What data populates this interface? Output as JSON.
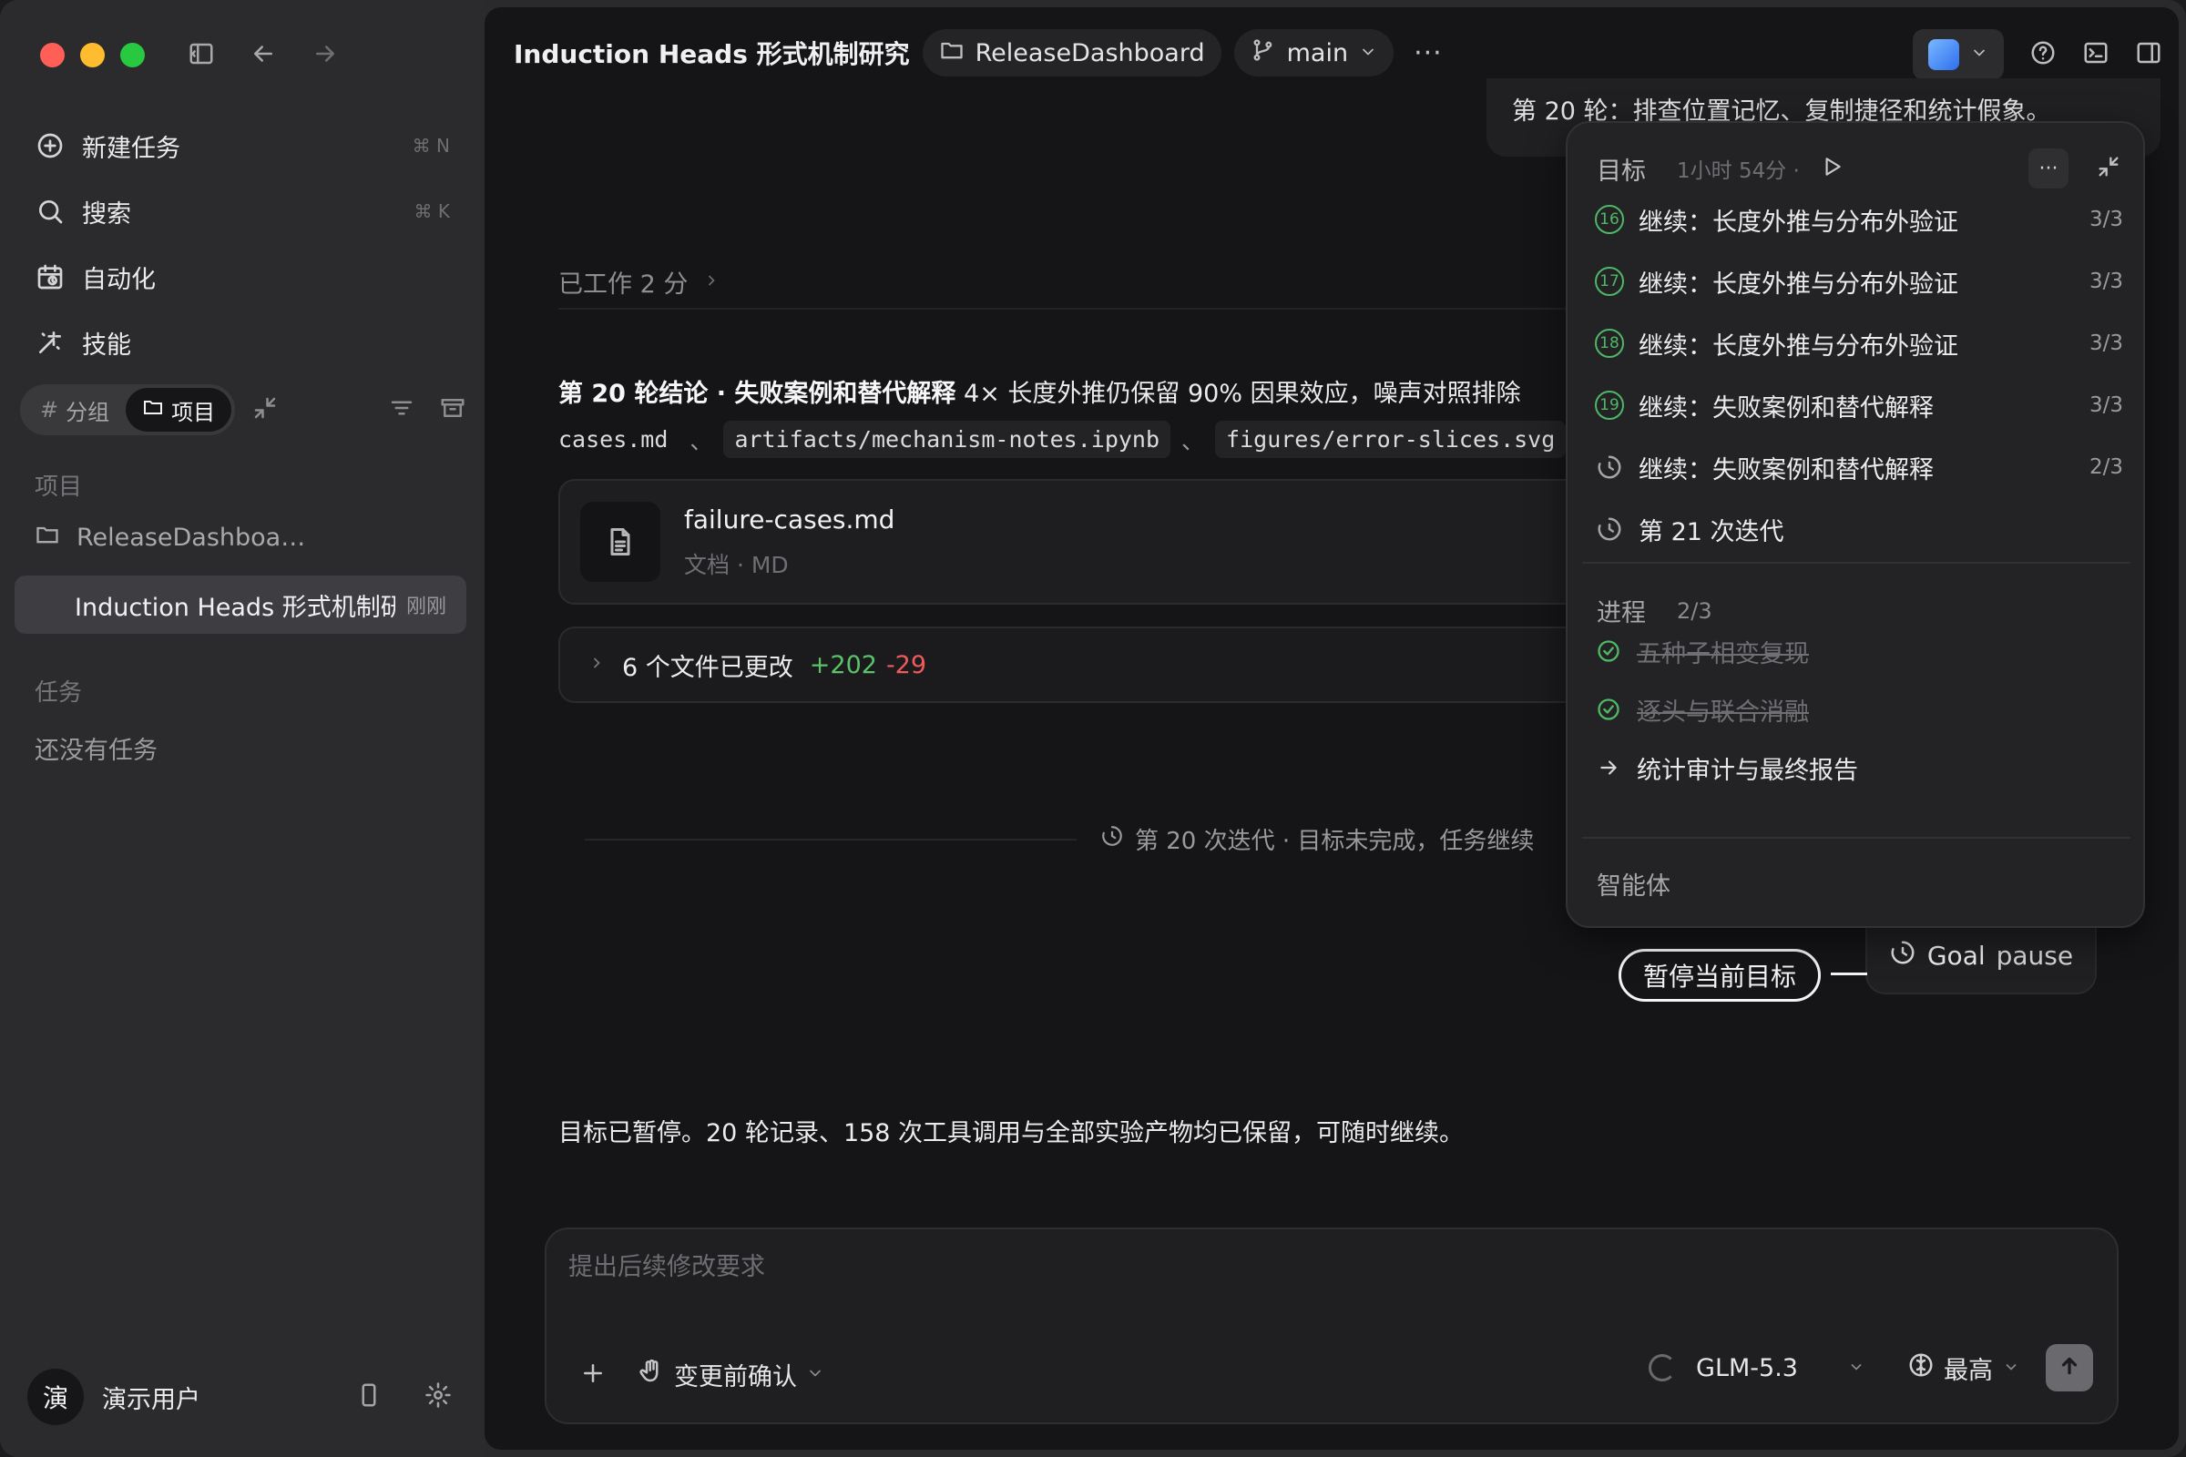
{
  "sidebar": {
    "nav": [
      {
        "label": "新建任务",
        "shortcut": "⌘ N",
        "icon": "new-task-icon"
      },
      {
        "label": "搜索",
        "shortcut": "⌘ K",
        "icon": "search-icon"
      },
      {
        "label": "自动化",
        "shortcut": "",
        "icon": "automation-icon"
      },
      {
        "label": "技能",
        "shortcut": "",
        "icon": "skills-icon"
      }
    ],
    "segment": {
      "group_label": "分组",
      "project_label": "项目",
      "active": "项目"
    },
    "projects_header": "项目",
    "projects": [
      {
        "label": "ReleaseDashboa…",
        "meta": ""
      },
      {
        "label": "Induction Heads 形式机制研",
        "meta": "刚刚"
      }
    ],
    "tasks_header": "任务",
    "tasks_empty": "还没有任务",
    "user": {
      "avatar_initial": "演",
      "name": "演示用户"
    }
  },
  "topbar": {
    "title": "Induction Heads 形式机制研究",
    "project": "ReleaseDashboard",
    "branch": "main",
    "more": "···"
  },
  "conversation": {
    "prev_message": "第 20 轮：排查位置记忆、复制捷径和统计假象。",
    "worked_label": "已工作 2 分",
    "conclusion_bold": "第 20 轮结论 · 失败案例和替代解释",
    "conclusion_rest": " 4× 长度外推仍保留 90% 因果效应，噪声对照排除",
    "file_refs": [
      "cases.md",
      "artifacts/mechanism-notes.ipynb",
      "figures/error-slices.svg"
    ],
    "file_ref_separator": "、",
    "file_card": {
      "name": "failure-cases.md",
      "meta": "文档 · MD"
    },
    "changes": {
      "label": "6 个文件已更改",
      "added": "+202",
      "removed": "-29"
    },
    "iteration_note": "第 20 次迭代 · 目标未完成，任务继续",
    "goal_chip": {
      "label": "Goal",
      "sub": "pause"
    },
    "callout": "暂停当前目标",
    "paused_message": "目标已暂停。20 轮记录、158 次工具调用与全部实验产物均已保留，可随时继续。"
  },
  "composer": {
    "placeholder": "提出后续修改要求",
    "confirm_mode": "变更前确认",
    "model": "GLM-5.3",
    "effort": "最高"
  },
  "goal_panel": {
    "title": "目标",
    "elapsed": "1小时 54分 ·",
    "iterations": [
      {
        "num": "16",
        "label": "继续：长度外推与分布外验证",
        "count": "3/3",
        "state": "done"
      },
      {
        "num": "17",
        "label": "继续：长度外推与分布外验证",
        "count": "3/3",
        "state": "done"
      },
      {
        "num": "18",
        "label": "继续：长度外推与分布外验证",
        "count": "3/3",
        "state": "done"
      },
      {
        "num": "19",
        "label": "继续：失败案例和替代解释",
        "count": "3/3",
        "state": "done"
      },
      {
        "num": "",
        "label": "继续：失败案例和替代解释",
        "count": "2/3",
        "state": "running"
      },
      {
        "num": "",
        "label": "第 21 次迭代",
        "count": "",
        "state": "pending"
      }
    ],
    "progress_title": "进程",
    "progress_value": "2/3",
    "progress_items": [
      {
        "label": "五种子相变复现",
        "state": "done"
      },
      {
        "label": "逐头与联合消融",
        "state": "done"
      },
      {
        "label": "统计审计与最终报告",
        "state": "current"
      }
    ],
    "agents_title": "智能体"
  },
  "colors": {
    "success": "#4fb866",
    "removed": "#ef5a5a",
    "added": "#5cc26a"
  }
}
